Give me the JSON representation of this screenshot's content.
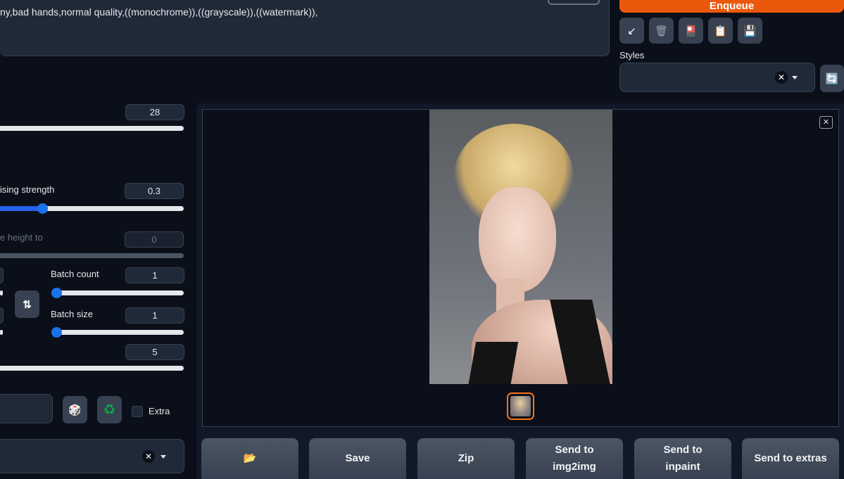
{
  "negative_prompt": {
    "value": "ny,bad hands,normal quality,((monochrome)),((grayscale)),((watermark)),"
  },
  "enqueue_label": "Enqueue",
  "tools": [
    {
      "icon": "arrow-icon",
      "glyph": "↙"
    },
    {
      "icon": "trash-icon",
      "glyph": "🗑"
    },
    {
      "icon": "image-icon",
      "glyph": "🎴"
    },
    {
      "icon": "clipboard-icon",
      "glyph": "📋"
    },
    {
      "icon": "save-icon",
      "glyph": "💾"
    }
  ],
  "styles": {
    "label": "Styles",
    "refresh_glyph": "🔄"
  },
  "params": {
    "steps": {
      "value": "28"
    },
    "denoise": {
      "label": "ising strength",
      "value": "0.3",
      "fraction": 0.23
    },
    "resize_height": {
      "label": "e height to",
      "value": "0"
    },
    "batch_count": {
      "label": "Batch count",
      "value": "1"
    },
    "batch_size": {
      "label": "Batch size",
      "value": "1"
    },
    "cfg": {
      "value": "5"
    },
    "swap_glyph": "⇅",
    "dice_glyph": "🎲",
    "recycle_glyph": "♻",
    "extra_label": "Extra"
  },
  "gallery": {
    "close_glyph": "✕"
  },
  "actions": {
    "folder": "📂",
    "save": "Save",
    "zip": "Zip",
    "img2img": "Send to img2img",
    "inpaint": "Send to inpaint",
    "extras": "Send to extras"
  }
}
